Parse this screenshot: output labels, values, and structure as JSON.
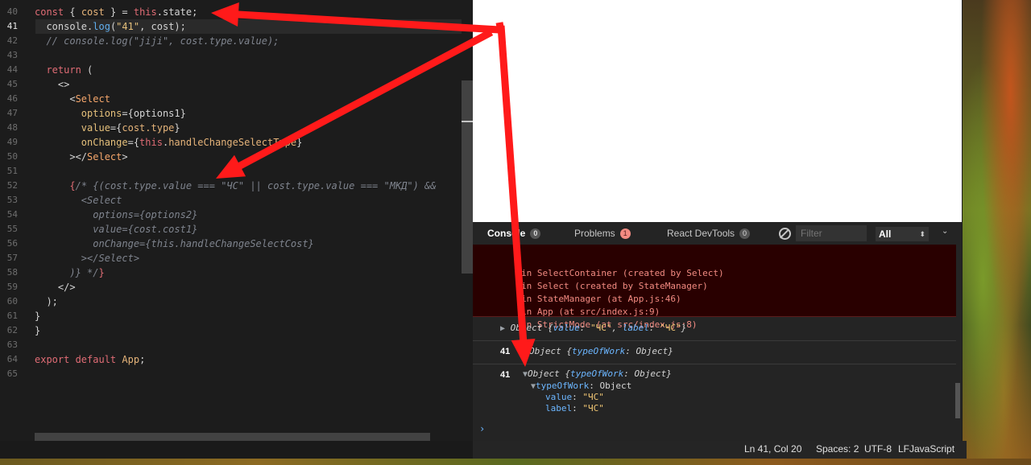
{
  "editor": {
    "lines": [
      {
        "n": "40",
        "active": false,
        "html": "<span class='kw'>const</span> { <span class='var'>cost</span> } = <span class='kw'>this</span>.state;"
      },
      {
        "n": "41",
        "active": true,
        "html": "  console.<span class='fn'>log</span>(<span class='str'>\"41\"</span>, cost);"
      },
      {
        "n": "42",
        "active": false,
        "html": "  <span class='cm'>// console.log(\"jiji\", cost.type.value);</span>"
      },
      {
        "n": "43",
        "active": false,
        "html": ""
      },
      {
        "n": "44",
        "active": false,
        "html": "  <span class='kw'>return</span> ("
      },
      {
        "n": "45",
        "active": false,
        "html": "    &lt;&gt;"
      },
      {
        "n": "46",
        "active": false,
        "html": "      &lt;<span class='tag'>Select</span>"
      },
      {
        "n": "47",
        "active": false,
        "html": "        <span class='attr'>options</span>={options1}"
      },
      {
        "n": "48",
        "active": false,
        "html": "        <span class='attr'>value</span>={<span class='var'>cost.type</span>}"
      },
      {
        "n": "49",
        "active": false,
        "html": "        <span class='attr'>onChange</span>={<span class='kw'>this</span>.<span class='var'>handleChangeSelectType</span>}"
      },
      {
        "n": "50",
        "active": false,
        "html": "      &gt;&lt;/<span class='tag'>Select</span>&gt;"
      },
      {
        "n": "51",
        "active": false,
        "html": ""
      },
      {
        "n": "52",
        "active": false,
        "html": "      <span class='kw'>{</span><span class='cm'>/* {(cost.type.value === \"ЧС\" || cost.type.value === \"МКД\") &amp;&amp;</span>"
      },
      {
        "n": "53",
        "active": false,
        "html": "        <span class='cm'>&lt;Select</span>"
      },
      {
        "n": "54",
        "active": false,
        "html": "          <span class='cm'>options={options2}</span>"
      },
      {
        "n": "55",
        "active": false,
        "html": "          <span class='cm'>value={cost.cost1}</span>"
      },
      {
        "n": "56",
        "active": false,
        "html": "          <span class='cm'>onChange={this.handleChangeSelectCost}</span>"
      },
      {
        "n": "57",
        "active": false,
        "html": "        <span class='cm'>&gt;&lt;/Select&gt;</span>"
      },
      {
        "n": "58",
        "active": false,
        "html": "      <span class='cm'>)} */</span><span class='kw'>}</span>"
      },
      {
        "n": "59",
        "active": false,
        "html": "    &lt;/&gt;"
      },
      {
        "n": "60",
        "active": false,
        "html": "  );"
      },
      {
        "n": "61",
        "active": false,
        "html": "}"
      },
      {
        "n": "62",
        "active": false,
        "html": "}"
      },
      {
        "n": "63",
        "active": false,
        "html": ""
      },
      {
        "n": "64",
        "active": false,
        "html": "<span class='kw'>export default</span> <span class='var'>App</span>;"
      },
      {
        "n": "65",
        "active": false,
        "html": ""
      }
    ]
  },
  "devtools": {
    "tabs": {
      "console": "Console",
      "console_count": "0",
      "problems": "Problems",
      "problems_count": "1",
      "react": "React DevTools",
      "react_count": "0"
    },
    "filter_placeholder": "Filter",
    "level": "All",
    "error_lines": [
      "in SelectContainer (created by Select)",
      "in Select (created by StateManager)",
      "in StateManager (at App.js:46)",
      "in App (at src/index.js:9)",
      "in StrictMode (at src/index.js:8)"
    ],
    "log1": {
      "prefix": "Object {",
      "k1": "value",
      "v1": "\"ЧС\"",
      "k2": "label",
      "v2": "\"ЧС\"",
      "suffix": "}"
    },
    "log2": {
      "num": "41",
      "prefix": "Object {",
      "k1": "typeOfWork",
      "v1": "Object",
      "suffix": "}"
    },
    "log3": {
      "num": "41",
      "prefix": "Object {",
      "k1": "typeOfWork",
      "v1": "Object",
      "suffix": "}",
      "child_key": "typeOfWork",
      "child_val": "Object",
      "value_key": "value",
      "value_val": "\"ЧС\"",
      "label_key": "label",
      "label_val": "\"ЧС\""
    },
    "prompt": "›"
  },
  "statusbar": {
    "position": "Ln 41, Col 20",
    "spaces": "Spaces: 2",
    "encoding": "UTF-8",
    "eol": "LF",
    "language": "JavaScript"
  },
  "annotation_color": "#ff1a1a"
}
